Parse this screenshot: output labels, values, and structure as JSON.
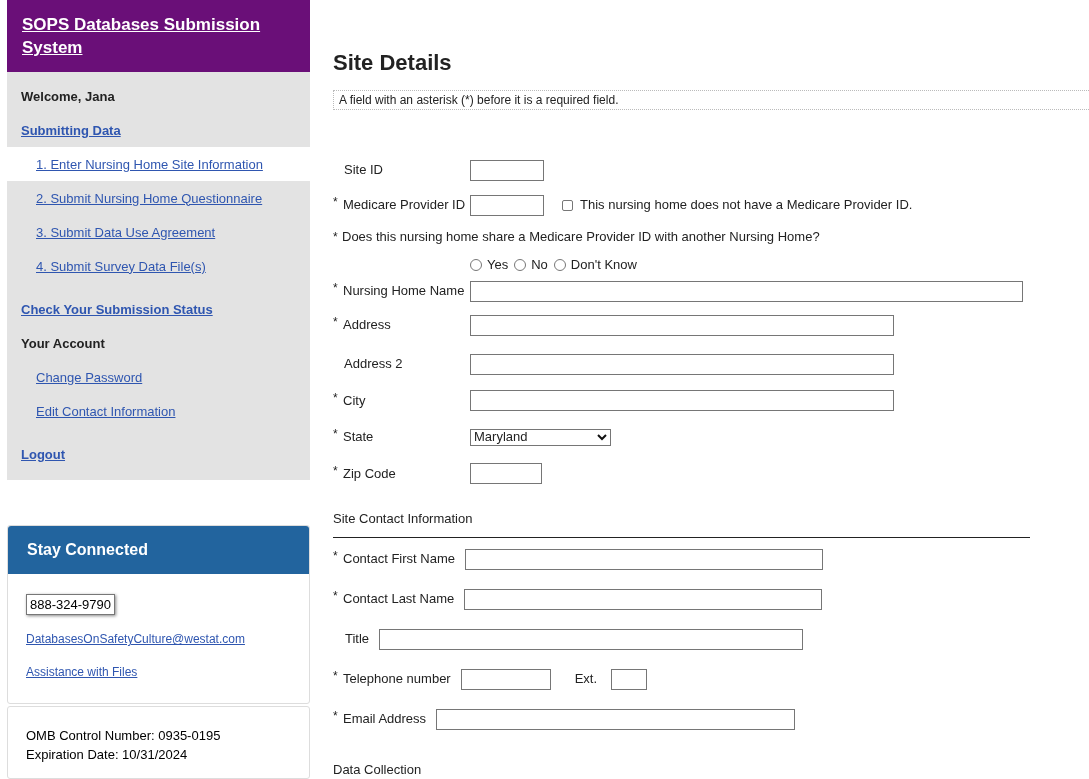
{
  "header": {
    "title": "SOPS Databases Submission System"
  },
  "sidebar": {
    "items": [
      {
        "kind": "label",
        "label": "Welcome, Jana",
        "selected": false
      },
      {
        "kind": "section",
        "label": "Submitting Data",
        "selected": false
      },
      {
        "kind": "sub",
        "label": "1. Enter Nursing Home Site Information",
        "selected": true
      },
      {
        "kind": "sub",
        "label": "2. Submit Nursing Home Questionnaire",
        "selected": false
      },
      {
        "kind": "sub",
        "label": "3. Submit Data Use Agreement",
        "selected": false
      },
      {
        "kind": "sub",
        "label": "4. Submit Survey Data File(s)",
        "selected": false
      },
      {
        "kind": "section",
        "label": "Check Your Submission Status",
        "selected": false
      },
      {
        "kind": "label",
        "label": "Your Account",
        "selected": false
      },
      {
        "kind": "sub",
        "label": "Change Password",
        "selected": false
      },
      {
        "kind": "sub",
        "label": "Edit Contact Information",
        "selected": false
      },
      {
        "kind": "section",
        "label": "Logout",
        "selected": false
      }
    ]
  },
  "stay_connected": {
    "title": "Stay Connected",
    "phone": "888-324-9790",
    "links": [
      "DatabasesOnSafetyCulture@westat.com",
      "Assistance with Files"
    ]
  },
  "omb": {
    "lines": [
      "OMB Control Number: 0935-0195",
      "Expiration Date: 10/31/2024"
    ]
  },
  "main": {
    "title": "Site Details",
    "note": "A field with an asterisk (*) before it is a required field.",
    "site_fields": [
      {
        "kind": "text",
        "label": "Site ID"
      },
      {
        "kind": "text",
        "marker": "*",
        "label": "Medicare Provider ID",
        "checkbox": {
          "label": "This nursing home does not have a Medicare Provider ID.",
          "checked": false
        }
      },
      {
        "kind": "radio",
        "marker": "*",
        "label": "Does this nursing home share a Medicare Provider ID with another Nursing Home?",
        "options": [
          {
            "label": "Yes",
            "selected": false
          },
          {
            "label": "No",
            "selected": false
          },
          {
            "label": "Don't Know",
            "selected": false
          }
        ]
      },
      {
        "kind": "text",
        "marker": "*",
        "label": "Nursing Home Name"
      },
      {
        "kind": "text",
        "marker": "*",
        "label": "Address"
      },
      {
        "kind": "text",
        "label": "Address 2"
      },
      {
        "kind": "text",
        "marker": "*",
        "label": "City"
      },
      {
        "kind": "select",
        "marker": "*",
        "label": "State",
        "value": "Maryland"
      },
      {
        "kind": "text",
        "marker": "*",
        "label": "Zip Code"
      }
    ],
    "contact_section": "Site Contact Information",
    "contact_fields": [
      {
        "kind": "text",
        "marker": "*",
        "label": "Contact First Name"
      },
      {
        "kind": "text",
        "marker": "*",
        "label": "Contact Last Name"
      },
      {
        "kind": "text",
        "label": "Title"
      },
      {
        "kind": "text",
        "marker": "*",
        "label": "Telephone number",
        "extension": {
          "label": "Ext."
        }
      },
      {
        "kind": "text",
        "marker": "*",
        "label": "Email Address"
      }
    ],
    "data_section": "Data Collection"
  }
}
